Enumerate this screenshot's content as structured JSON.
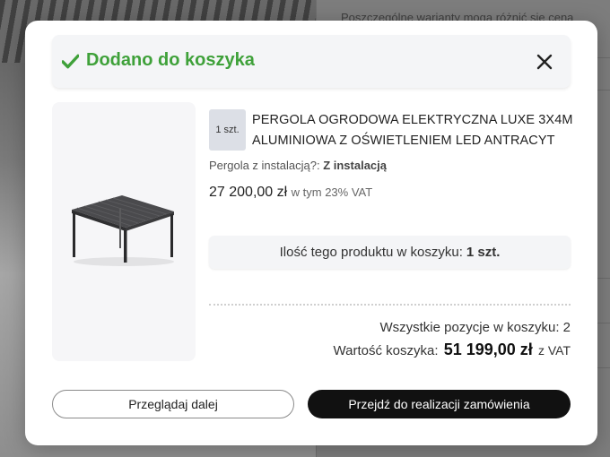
{
  "background": {
    "notice_text": "Poszczególne warianty mogą różnić się ceną",
    "accent_green": "#3fa13a"
  },
  "modal": {
    "title": "Dodano do koszyka",
    "check_icon": "check-icon",
    "close_icon": "close-icon"
  },
  "product": {
    "qty_badge": "1 szt.",
    "name": "PERGOLA OGRODOWA ELEKTRYCZNA LUXE 3X4M ALUMINIOWA Z OŚWIETLENIEM LED ANTRACYT",
    "variant_label": "Pergola z instalacją?: ",
    "variant_value": "Z instalacją",
    "price": "27 200,00 zł",
    "price_vat": "w tym 23% VAT",
    "image_icon": "pergola-image"
  },
  "cart_qty": {
    "label": "Ilość tego produktu w koszyku:",
    "value": "1 szt."
  },
  "summary": {
    "items_label": "Wszystkie pozycje w koszyku:",
    "items_count": "2",
    "value_label": "Wartość koszyka:",
    "value_amount": "51 199,00 zł",
    "value_vat": "z VAT"
  },
  "buttons": {
    "continue_label": "Przeglądaj dalej",
    "checkout_label": "Przejdź do realizacji zamówienia"
  }
}
